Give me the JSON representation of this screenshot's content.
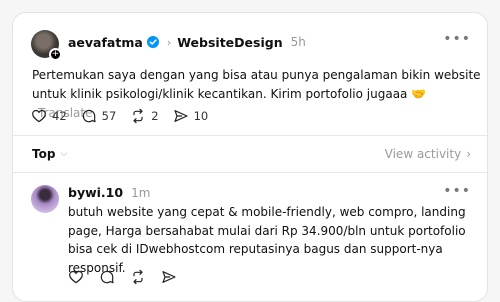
{
  "post": {
    "username": "aevafatma",
    "topic": "WebsiteDesign",
    "time": "5h",
    "more": "•••",
    "text": "Pertemukan saya dengan yang bisa atau punya pengalaman bikin website untuk klinik psikologi/klinik kecantikan. Kirim portofolio jugaaa 🤝",
    "translate": "Translate",
    "likes": "42",
    "comments": "57",
    "reposts": "2",
    "shares": "10"
  },
  "sort": {
    "label": "Top",
    "view_activity": "View activity"
  },
  "reply": {
    "username": "bywi.10",
    "time": "1m",
    "more": "•••",
    "text": "butuh website yang cepat & mobile-friendly, web compro, landing page, Harga bersahabat mulai dari Rp 34.900/bln untuk portofolio bisa cek di IDwebhostcom reputasinya bagus dan support-nya responsif."
  },
  "colors": {
    "verified": "#0095f6",
    "muted": "#999999",
    "text": "#101010"
  }
}
